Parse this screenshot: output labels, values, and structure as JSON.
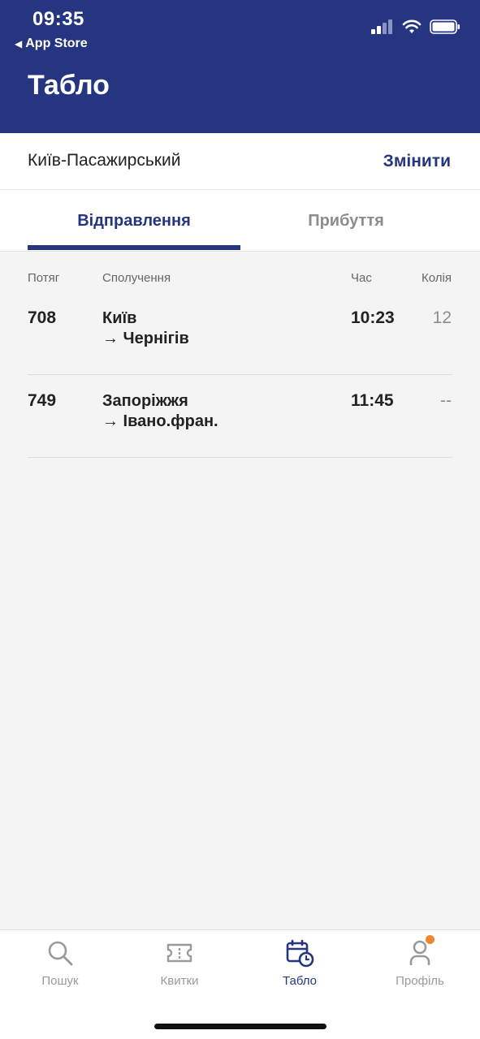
{
  "status_bar": {
    "time": "09:35",
    "back_label": "App Store",
    "icons": [
      "cellular-signal-icon",
      "wifi-icon",
      "battery-icon"
    ]
  },
  "header": {
    "title": "Табло"
  },
  "station": {
    "name": "Київ-Пасажирський",
    "change_label": "Змінити"
  },
  "tabs": [
    {
      "label": "Відправлення",
      "active": true
    },
    {
      "label": "Прибуття",
      "active": false
    }
  ],
  "table": {
    "columns": {
      "train": "Потяг",
      "route": "Сполучення",
      "time": "Час",
      "track": "Колія"
    },
    "rows": [
      {
        "train": "708",
        "from": "Київ",
        "to": "→ Чернігів",
        "time": "10:23",
        "track": "12"
      },
      {
        "train": "749",
        "from": "Запоріжжя",
        "to": "→ Івано.фран.",
        "time": "11:45",
        "track": "--"
      }
    ]
  },
  "bottom_nav": [
    {
      "label": "Пошук",
      "icon": "search-icon",
      "active": false
    },
    {
      "label": "Квитки",
      "icon": "ticket-icon",
      "active": false
    },
    {
      "label": "Табло",
      "icon": "calendar-clock-icon",
      "active": true
    },
    {
      "label": "Профіль",
      "icon": "profile-icon",
      "active": false,
      "notification": true
    }
  ],
  "colors": {
    "brand": "#26357f",
    "inactive": "#9a9a9a",
    "notification": "#f0862f",
    "background": "#f4f4f4"
  }
}
